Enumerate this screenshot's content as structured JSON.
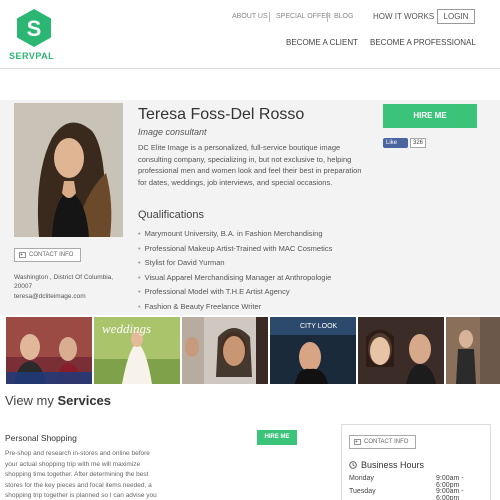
{
  "header": {
    "brand": "SERVPAL",
    "top_links": [
      "ABOUT US",
      "SPECIAL OFFER",
      "BLOG"
    ],
    "how_it_works": "HOW IT WORKS",
    "login": "LOGIN",
    "main_nav": [
      "BECOME A CLIENT",
      "BECOME A PROFESSIONAL"
    ]
  },
  "profile": {
    "name": "Teresa Foss-Del Rosso",
    "role": "Image consultant",
    "bio": "DC Elite Image is a personalized, full-service boutique image consulting company, specializing in, but not exclusive to, helping professional men and women look and feel their best in preparation for dates, weddings, job interviews, and special occasions.",
    "qualifications_title": "Qualifications",
    "qualifications": [
      "Marymount University, B.A. in Fashion Merchandising",
      "Professional Makeup Artist-Trained with MAC Cosmetics",
      "Stylist for David Yurman",
      "Visual Apparel Merchandising Manager at Anthropologie",
      "Professional Model with T.H.E Artist Agency",
      "Fashion & Beauty Freelance Writer"
    ],
    "contact_label": "CONTACT INFO",
    "location": "Washington , District Of Columbia, 20007",
    "email": "teresa@dcliteimage.com",
    "hire_label": "HIRE ME",
    "like_label": "Like",
    "like_count": "326"
  },
  "gallery": {
    "tile_texts": [
      "weddings",
      "CITY LOOK"
    ]
  },
  "services": {
    "title_prefix": "View my",
    "title_bold": "Services",
    "items": [
      {
        "name": "Personal Shopping",
        "hire_label": "HIRE ME",
        "description": "Pre-shop and research in-stores and online before your actual shopping trip with me will maximize shopping time together. After determining the best stores for the key pieces and focal items needed, a shopping trip together is planned so I can advise you"
      }
    ]
  },
  "side_panel": {
    "contact_label": "CONTACT INFO",
    "hours_title": "Business Hours",
    "hours": [
      {
        "day": "Monday",
        "time": "9:00am - 6:00pm"
      },
      {
        "day": "Tuesday",
        "time": "9:00am - 6:00pm"
      }
    ]
  },
  "colors": {
    "brand_green": "#2bb673",
    "button_green": "#3cc37a",
    "facebook_blue": "#4a66a0"
  }
}
